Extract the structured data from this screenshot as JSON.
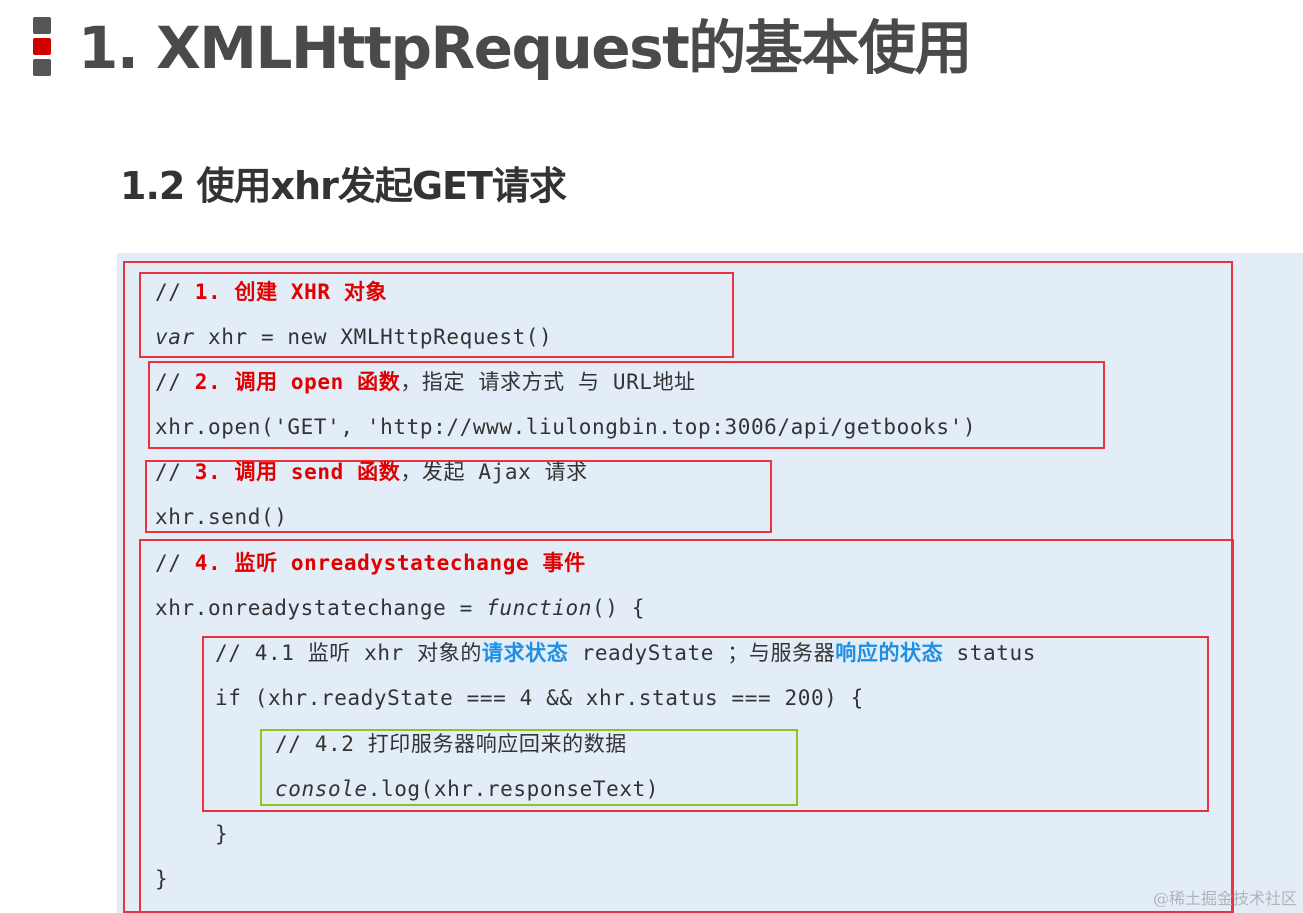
{
  "heading": {
    "title": "1. XMLHttpRequest的基本使用",
    "subtitle": "1.2 使用xhr发起GET请求"
  },
  "code": {
    "step1_prefix": "// ",
    "step1_label": "1. 创建 XHR 对象",
    "step1_code_keyword": "var",
    "step1_code_rest": " xhr = new XMLHttpRequest()",
    "step2_prefix": "// ",
    "step2_label": "2. 调用 open 函数",
    "step2_suffix": "，指定 请求方式 与 URL地址",
    "step2_code": "xhr.open('GET', 'http://www.liulongbin.top:3006/api/getbooks')",
    "step3_prefix": "// ",
    "step3_label": "3. 调用 send 函数",
    "step3_suffix": "，发起 Ajax 请求",
    "step3_code": "xhr.send()",
    "step4_prefix": "// ",
    "step4_label": "4. 监听 onreadystatechange 事件",
    "step4_code_start": "xhr.onreadystatechange = ",
    "step4_code_keyword": "function",
    "step4_code_end": "() {",
    "step41_comment_a": "// 4.1 监听 xhr 对象的",
    "step41_highlight_a": "请求状态",
    "step41_comment_b": " readyState ；与服务器",
    "step41_highlight_b": "响应的状态",
    "step41_comment_c": " status",
    "step41_code": "if (xhr.readyState === 4 && xhr.status === 200) {",
    "step42_comment": "// 4.2 打印服务器响应回来的数据",
    "step42_code_obj": "console",
    "step42_code_rest": ".log(xhr.responseText)",
    "close_inner": "}",
    "close_outer": "}"
  },
  "watermark": "@稀土掘金技术社区",
  "colors": {
    "title_text": "#4a4a4a",
    "panel_background": "#e3edf8",
    "comment_red": "#e00000",
    "highlight_blue": "#1e8fe1",
    "box_red": "#e8343e",
    "box_green": "#8fc31f"
  }
}
